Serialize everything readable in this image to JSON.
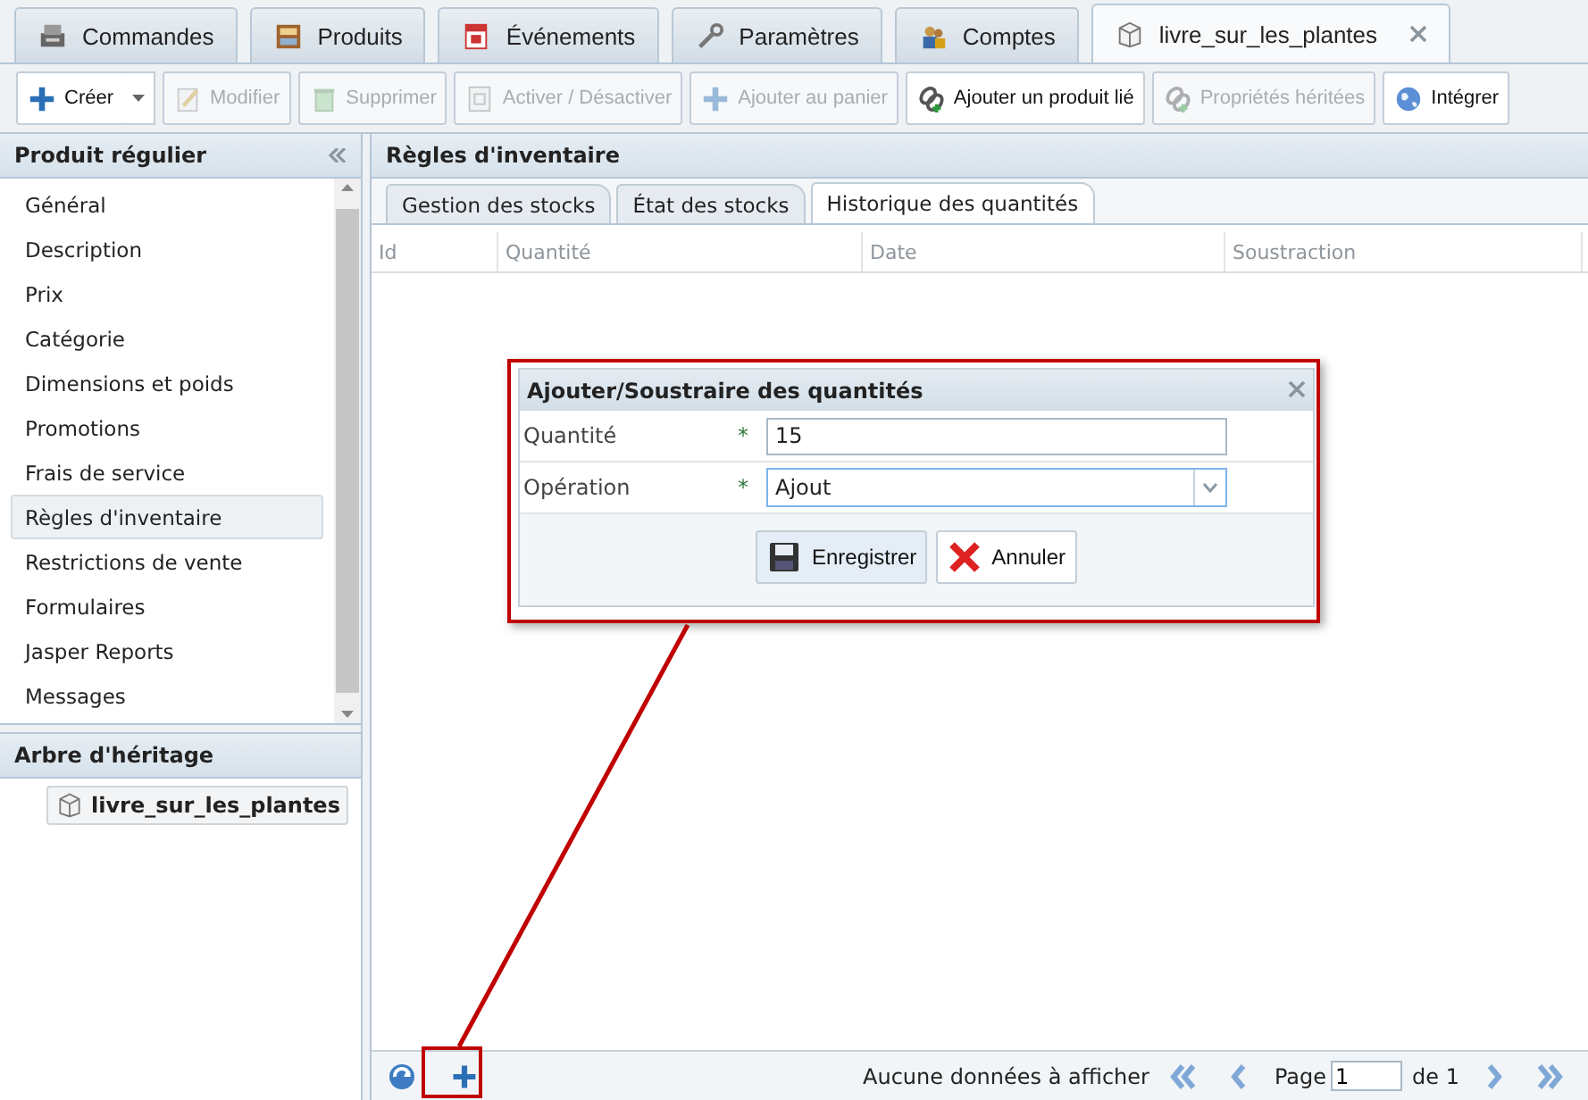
{
  "app_tabs": [
    {
      "label": "Commandes",
      "selected": false
    },
    {
      "label": "Produits",
      "selected": false
    },
    {
      "label": "Événements",
      "selected": false
    },
    {
      "label": "Paramètres",
      "selected": false
    },
    {
      "label": "Comptes",
      "selected": false
    },
    {
      "label": "livre_sur_les_plantes",
      "selected": true
    }
  ],
  "toolbar": [
    {
      "label": "Créer",
      "disabled": false
    },
    {
      "label": "Modifier",
      "disabled": true
    },
    {
      "label": "Supprimer",
      "disabled": true
    },
    {
      "label": "Activer / Désactiver",
      "disabled": true
    },
    {
      "label": "Ajouter au panier",
      "disabled": true
    },
    {
      "label": "Ajouter un produit lié",
      "disabled": false
    },
    {
      "label": "Propriétés héritées",
      "disabled": true
    },
    {
      "label": "Intégrer",
      "disabled": false
    }
  ],
  "left_panel": {
    "title": "Produit régulier",
    "items": [
      {
        "label": "Général",
        "selected": false
      },
      {
        "label": "Description",
        "selected": false
      },
      {
        "label": "Prix",
        "selected": false
      },
      {
        "label": "Catégorie",
        "selected": false
      },
      {
        "label": "Dimensions et poids",
        "selected": false
      },
      {
        "label": "Promotions",
        "selected": false
      },
      {
        "label": "Frais de service",
        "selected": false
      },
      {
        "label": "Règles d'inventaire",
        "selected": true
      },
      {
        "label": "Restrictions de vente",
        "selected": false
      },
      {
        "label": "Formulaires",
        "selected": false
      },
      {
        "label": "Jasper Reports",
        "selected": false
      },
      {
        "label": "Messages",
        "selected": false
      }
    ]
  },
  "inheritance": {
    "title": "Arbre d'héritage",
    "items": [
      {
        "label": "livre_sur_les_plantes"
      }
    ]
  },
  "main": {
    "title": "Règles d'inventaire",
    "tabs": [
      {
        "label": "Gestion des stocks",
        "selected": false
      },
      {
        "label": "État des stocks",
        "selected": false
      },
      {
        "label": "Historique des quantités",
        "selected": true
      }
    ],
    "columns": [
      "Id",
      "Quantité",
      "Date",
      "Soustraction"
    ]
  },
  "pager": {
    "message": "Aucune données à afficher",
    "page_label": "Page",
    "page": "1",
    "of_label": "de 1"
  },
  "dialog": {
    "title": "Ajouter/Soustraire des quantités",
    "fields": [
      {
        "label": "Quantité",
        "required_mark": "*",
        "kind": "text",
        "value": "15"
      },
      {
        "label": "Opération",
        "required_mark": "*",
        "kind": "select",
        "value": "Ajout"
      }
    ],
    "buttons": [
      {
        "label": "Enregistrer"
      },
      {
        "label": "Annuler"
      }
    ]
  }
}
